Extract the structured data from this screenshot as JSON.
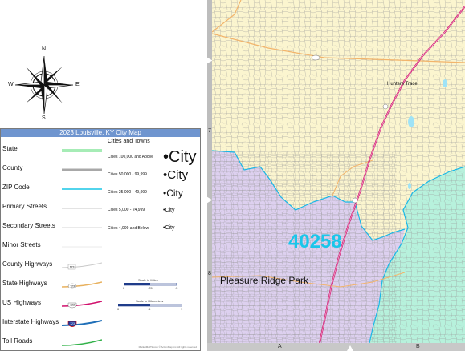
{
  "compass": {
    "north": "N",
    "south": "S",
    "east": "E",
    "west": "W"
  },
  "legend": {
    "title": "2023 Louisville, KY City Map",
    "items": [
      {
        "label": "State",
        "symbol": "state-line-icon"
      },
      {
        "label": "County",
        "symbol": "county-line-icon"
      },
      {
        "label": "ZIP Code",
        "symbol": "zip-line-icon"
      },
      {
        "label": "Primary Streets",
        "symbol": "primary-street-icon"
      },
      {
        "label": "Secondary Streets",
        "symbol": "secondary-street-icon"
      },
      {
        "label": "Minor Streets",
        "symbol": "minor-street-icon"
      },
      {
        "label": "County Highways",
        "symbol": "county-highway-icon",
        "shield": "123"
      },
      {
        "label": "State Highways",
        "symbol": "state-highway-icon",
        "shield": "123"
      },
      {
        "label": "US Highways",
        "symbol": "us-highway-icon",
        "shield": "123"
      },
      {
        "label": "Interstate Highways",
        "symbol": "interstate-icon",
        "shield": "123"
      },
      {
        "label": "Toll Roads",
        "symbol": "toll-road-icon"
      }
    ],
    "cities_title": "Cities and Towns",
    "cities": [
      {
        "label": "Cities 100,000 and Above",
        "sample": "•City"
      },
      {
        "label": "Cities 50,000 - 99,999",
        "sample": "•City"
      },
      {
        "label": "Cities 25,000 - 49,999",
        "sample": "•City"
      },
      {
        "label": "Cities 5,000 - 24,999",
        "sample": "•City"
      },
      {
        "label": "Cities 4,999 and Below",
        "sample": "•City"
      }
    ],
    "scale_miles": {
      "title": "Scale in Miles",
      "ticks": [
        "0",
        ".25",
        ".5"
      ]
    },
    "scale_km": {
      "title": "Scale in Kilometers",
      "ticks": [
        "0",
        ".5",
        "1"
      ]
    },
    "copyright": "MarketMAPS.com © ActionMap Inc. All rights reserved"
  },
  "map": {
    "zip": "40258",
    "places": [
      {
        "name": "Pleasure Ridge Park"
      },
      {
        "name": "Hunters Trace"
      }
    ],
    "colors": {
      "base": "#fbf5cf",
      "zip_40258": "#ddd0ef",
      "east_zip": "#b7f1dc",
      "zip_line": "#19b7e6",
      "highway": "#d1116d",
      "arterial": "#f2b46b"
    },
    "rulers": {
      "rows": [
        "7",
        "8"
      ],
      "cols": [
        "A",
        "B"
      ]
    }
  }
}
